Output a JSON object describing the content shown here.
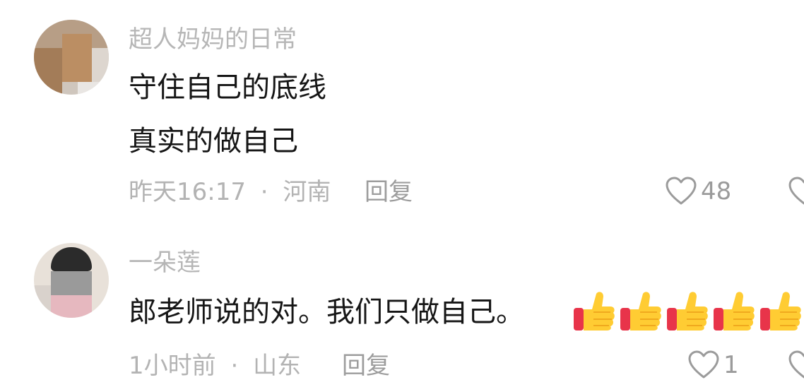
{
  "comments": [
    {
      "username": "超人妈妈的日常",
      "lines": [
        "守住自己的底线",
        "真实的做自己"
      ],
      "time": "昨天16:17",
      "separator": "·",
      "location": "河南",
      "reply_label": "回复",
      "like_count": "48",
      "like_icon": "heart-outline-icon"
    },
    {
      "username": "一朵莲",
      "lines": [
        "郎老师说的对。我们只做自己。"
      ],
      "emoji": [
        "👍",
        "👍",
        "👍",
        "👍",
        "👍"
      ],
      "time": "1小时前",
      "separator": "·",
      "location": "山东",
      "reply_label": "回复",
      "like_count": "1",
      "like_icon": "heart-outline-icon"
    }
  ],
  "colors": {
    "username": "#b6b6b6",
    "text": "#161616",
    "meta": "#b3b3b3",
    "icon": "#9b9b9b"
  }
}
